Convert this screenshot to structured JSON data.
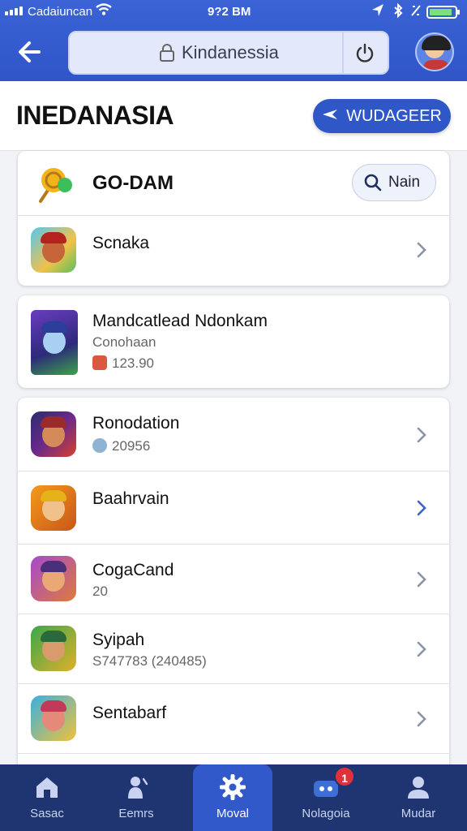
{
  "status_bar": {
    "carrier": "Cadaiuncan",
    "time": "9?2 BM",
    "battery_level": 0.9
  },
  "browser": {
    "url_text": "Kindanessia"
  },
  "header": {
    "title": "INEDANASIA",
    "action_label": "WUDAGEER"
  },
  "card1": {
    "brand": "GO-DAM",
    "search_label": "Nain",
    "item_title": "Scnaka"
  },
  "card2": {
    "title": "Mandcatlead Ndonkam",
    "subtitle": "Conohaan",
    "price": "123.90"
  },
  "list": [
    {
      "title": "Ronodation",
      "sub": "20956"
    },
    {
      "title": "Baahrvain",
      "sub": ""
    },
    {
      "title": "CogaCand",
      "sub": "20"
    },
    {
      "title": "Syipah",
      "sub": "S747783 (240485)"
    },
    {
      "title": "Sentabarf",
      "sub": ""
    }
  ],
  "nav": {
    "home": "Sasac",
    "events": "Eemrs",
    "main": "Moval",
    "notifications": "Nolagoia",
    "notifications_badge": "1",
    "profile": "Mudar"
  }
}
